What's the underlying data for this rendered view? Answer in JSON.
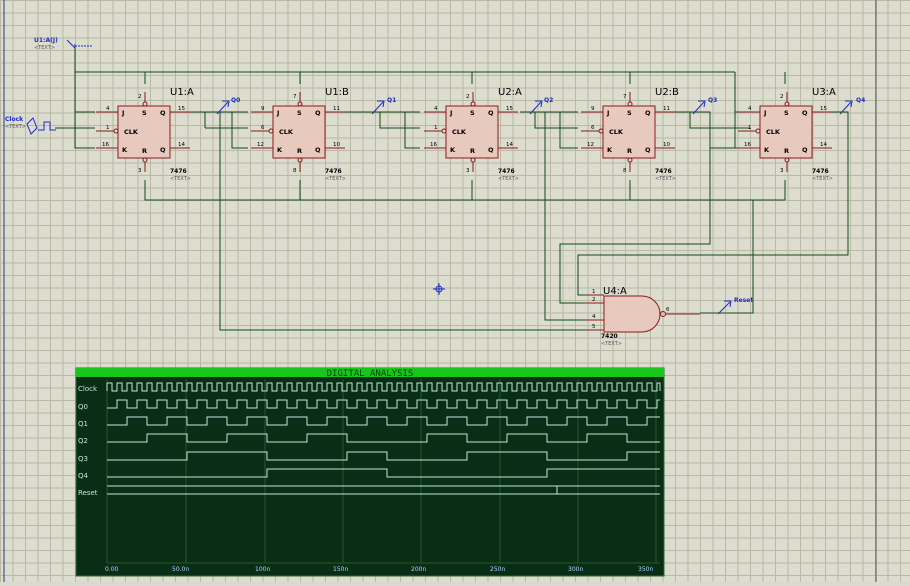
{
  "schematic": {
    "chips": [
      {
        "ref": "U1:A",
        "type": "7476",
        "clk_label": "CLK",
        "j_pin": "4",
        "clk_pin": "1",
        "k_pin": "16",
        "q_pin": "15",
        "qn_pin": "14",
        "pre_pin": "2",
        "clr_pin": "3"
      },
      {
        "ref": "U1:B",
        "type": "7476",
        "clk_label": "CLK",
        "j_pin": "9",
        "clk_pin": "6",
        "k_pin": "12",
        "q_pin": "11",
        "qn_pin": "10",
        "pre_pin": "7",
        "clr_pin": "8"
      },
      {
        "ref": "U2:A",
        "type": "7476",
        "clk_label": "CLK",
        "j_pin": "4",
        "clk_pin": "1",
        "k_pin": "16",
        "q_pin": "15",
        "qn_pin": "14",
        "pre_pin": "2",
        "clr_pin": "3"
      },
      {
        "ref": "U2:B",
        "type": "7476",
        "clk_label": "CLK",
        "j_pin": "9",
        "clk_pin": "6",
        "k_pin": "12",
        "q_pin": "11",
        "qn_pin": "10",
        "pre_pin": "7",
        "clr_pin": "8"
      },
      {
        "ref": "U3:A",
        "type": "7476",
        "clk_label": "CLK",
        "j_pin": "4",
        "clk_pin": "1",
        "k_pin": "16",
        "q_pin": "15",
        "qn_pin": "14",
        "pre_pin": "2",
        "clr_pin": "3"
      }
    ],
    "pin_letters": {
      "j": "J",
      "k": "K",
      "q": "Q",
      "qbar": "Q",
      "s": "S",
      "r": "R"
    },
    "text_placeholder": "<TEXT>",
    "probes": [
      "Q0",
      "Q1",
      "Q2",
      "Q3",
      "Q4"
    ],
    "clock_label": "Clock",
    "clock_text": "<TEXT>",
    "power_label": "U1:A(J)",
    "power_text": "<TEXT>",
    "gate": {
      "ref": "U4:A",
      "type": "7420",
      "text": "<TEXT>",
      "in_pins": [
        "1",
        "2",
        "4",
        "5"
      ],
      "out_pin": "6"
    },
    "reset_label": "Reset"
  },
  "analysis": {
    "title": "DIGITAL ANALYSIS",
    "traces": [
      "Clock",
      "Q0",
      "Q1",
      "Q2",
      "Q3",
      "Q4",
      "Reset"
    ],
    "x_ticks": [
      "0.00",
      "50.0n",
      "100n",
      "150n",
      "200n",
      "250n",
      "300n",
      "350n"
    ],
    "colors": {
      "bg": "#0a2e15",
      "header": "#17c61b",
      "trace": "#bfe7dd",
      "grid": "#1f5a2c",
      "tick_text": "#a7d7ff"
    }
  }
}
